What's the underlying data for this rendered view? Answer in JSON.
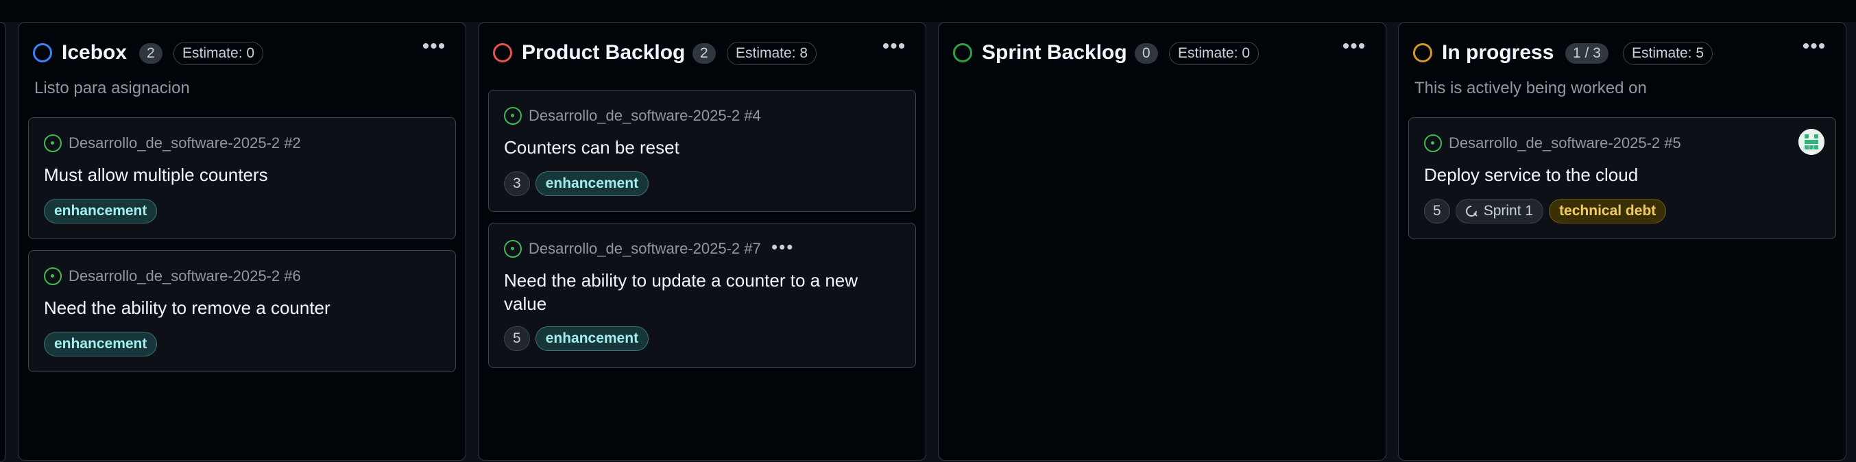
{
  "columns": [
    {
      "title": "Icebox",
      "count": "2",
      "estimate": "Estimate: 0",
      "description": "Listo para asignacion",
      "status_color": "#3b82f6",
      "cards": [
        {
          "repo": "Desarrollo_de_software-2025-2 #2",
          "title": "Must allow multiple counters",
          "labels": [
            "enhancement"
          ]
        },
        {
          "repo": "Desarrollo_de_software-2025-2 #6",
          "title": "Need the ability to remove a counter",
          "labels": [
            "enhancement"
          ]
        }
      ]
    },
    {
      "title": "Product Backlog",
      "count": "2",
      "estimate": "Estimate: 8",
      "description": "",
      "status_color": "#e5534b",
      "cards": [
        {
          "repo": "Desarrollo_de_software-2025-2 #4",
          "title": "Counters can be reset",
          "estimate": "3",
          "labels": [
            "enhancement"
          ]
        },
        {
          "repo": "Desarrollo_de_software-2025-2 #7",
          "title": "Need the ability to update a counter to a new value",
          "estimate": "5",
          "labels": [
            "enhancement"
          ],
          "menu": "•••"
        }
      ]
    },
    {
      "title": "Sprint Backlog",
      "count": "0",
      "estimate": "Estimate: 0",
      "description": "",
      "status_color": "#2ea043",
      "cards": []
    },
    {
      "title": "In progress",
      "count": "1 / 3",
      "estimate": "Estimate: 5",
      "description": "This is actively being worked on",
      "status_color": "#d29922",
      "cards": [
        {
          "repo": "Desarrollo_de_software-2025-2 #5",
          "title": "Deploy service to the cloud",
          "estimate": "5",
          "iteration": "Sprint 1",
          "labels": [
            "technical debt"
          ],
          "avatar_icon": "user-avatar-icon"
        }
      ]
    }
  ],
  "column_menu": "•••",
  "icons": {
    "status": "circle-status-icon",
    "issue": "issue-open-icon",
    "iteration": "iteration-icon"
  },
  "colors": {
    "background": "#0d1117",
    "column_bg": "#010409",
    "issue_open": "#3fb950",
    "enhancement_label": "#a2eeef",
    "technical_debt_label": "#f2cc60"
  }
}
